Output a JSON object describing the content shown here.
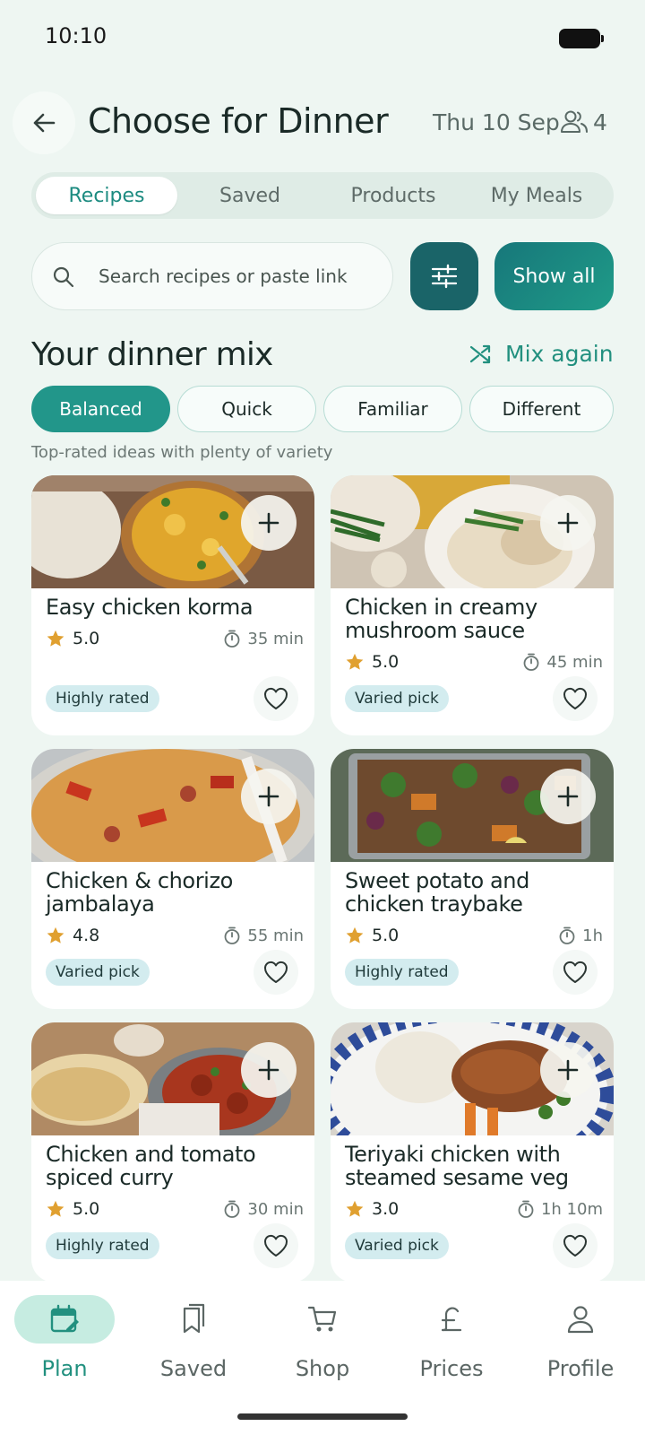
{
  "status_bar": {
    "time": "10:10"
  },
  "header": {
    "title": "Choose for Dinner",
    "date": "Thu 10 Sep",
    "people_count": "4"
  },
  "tabs": [
    {
      "label": "Recipes",
      "active": true
    },
    {
      "label": "Saved",
      "active": false
    },
    {
      "label": "Products",
      "active": false
    },
    {
      "label": "My Meals",
      "active": false
    }
  ],
  "search": {
    "placeholder": "Search recipes or paste link",
    "value": ""
  },
  "show_all_label": "Show all",
  "section": {
    "title": "Your dinner mix",
    "mix_again_label": "Mix again",
    "description": "Top-rated ideas with plenty of variety"
  },
  "chips": [
    {
      "label": "Balanced",
      "active": true
    },
    {
      "label": "Quick",
      "active": false
    },
    {
      "label": "Familiar",
      "active": false
    },
    {
      "label": "Different",
      "active": false
    }
  ],
  "recipes": [
    {
      "title": "Easy chicken korma",
      "rating": "5.0",
      "time": "35 min",
      "badge": "Highly rated"
    },
    {
      "title": "Chicken in creamy mushroom sauce",
      "rating": "5.0",
      "time": "45 min",
      "badge": "Varied pick"
    },
    {
      "title": "Chicken & chorizo jambalaya",
      "rating": "4.8",
      "time": "55 min",
      "badge": "Varied pick"
    },
    {
      "title": "Sweet potato and chicken traybake",
      "rating": "5.0",
      "time": "1h",
      "badge": "Highly rated"
    },
    {
      "title": "Chicken and tomato spiced curry",
      "rating": "5.0",
      "time": "30 min",
      "badge": "Highly rated"
    },
    {
      "title": "Teriyaki chicken with steamed sesame veg",
      "rating": "3.0",
      "time": "1h 10m",
      "badge": "Varied pick"
    }
  ],
  "bottom_nav": [
    {
      "label": "Plan",
      "icon": "calendar-edit-icon",
      "active": true
    },
    {
      "label": "Saved",
      "icon": "bookmarks-icon",
      "active": false
    },
    {
      "label": "Shop",
      "icon": "cart-icon",
      "active": false
    },
    {
      "label": "Prices",
      "icon": "pound-icon",
      "active": false
    },
    {
      "label": "Profile",
      "icon": "person-icon",
      "active": false
    }
  ],
  "colors": {
    "background": "#eef6f2",
    "accent": "#22968a",
    "dark_teal": "#1a6468",
    "star": "#e0a030",
    "badge_bg": "#d3ecef"
  }
}
